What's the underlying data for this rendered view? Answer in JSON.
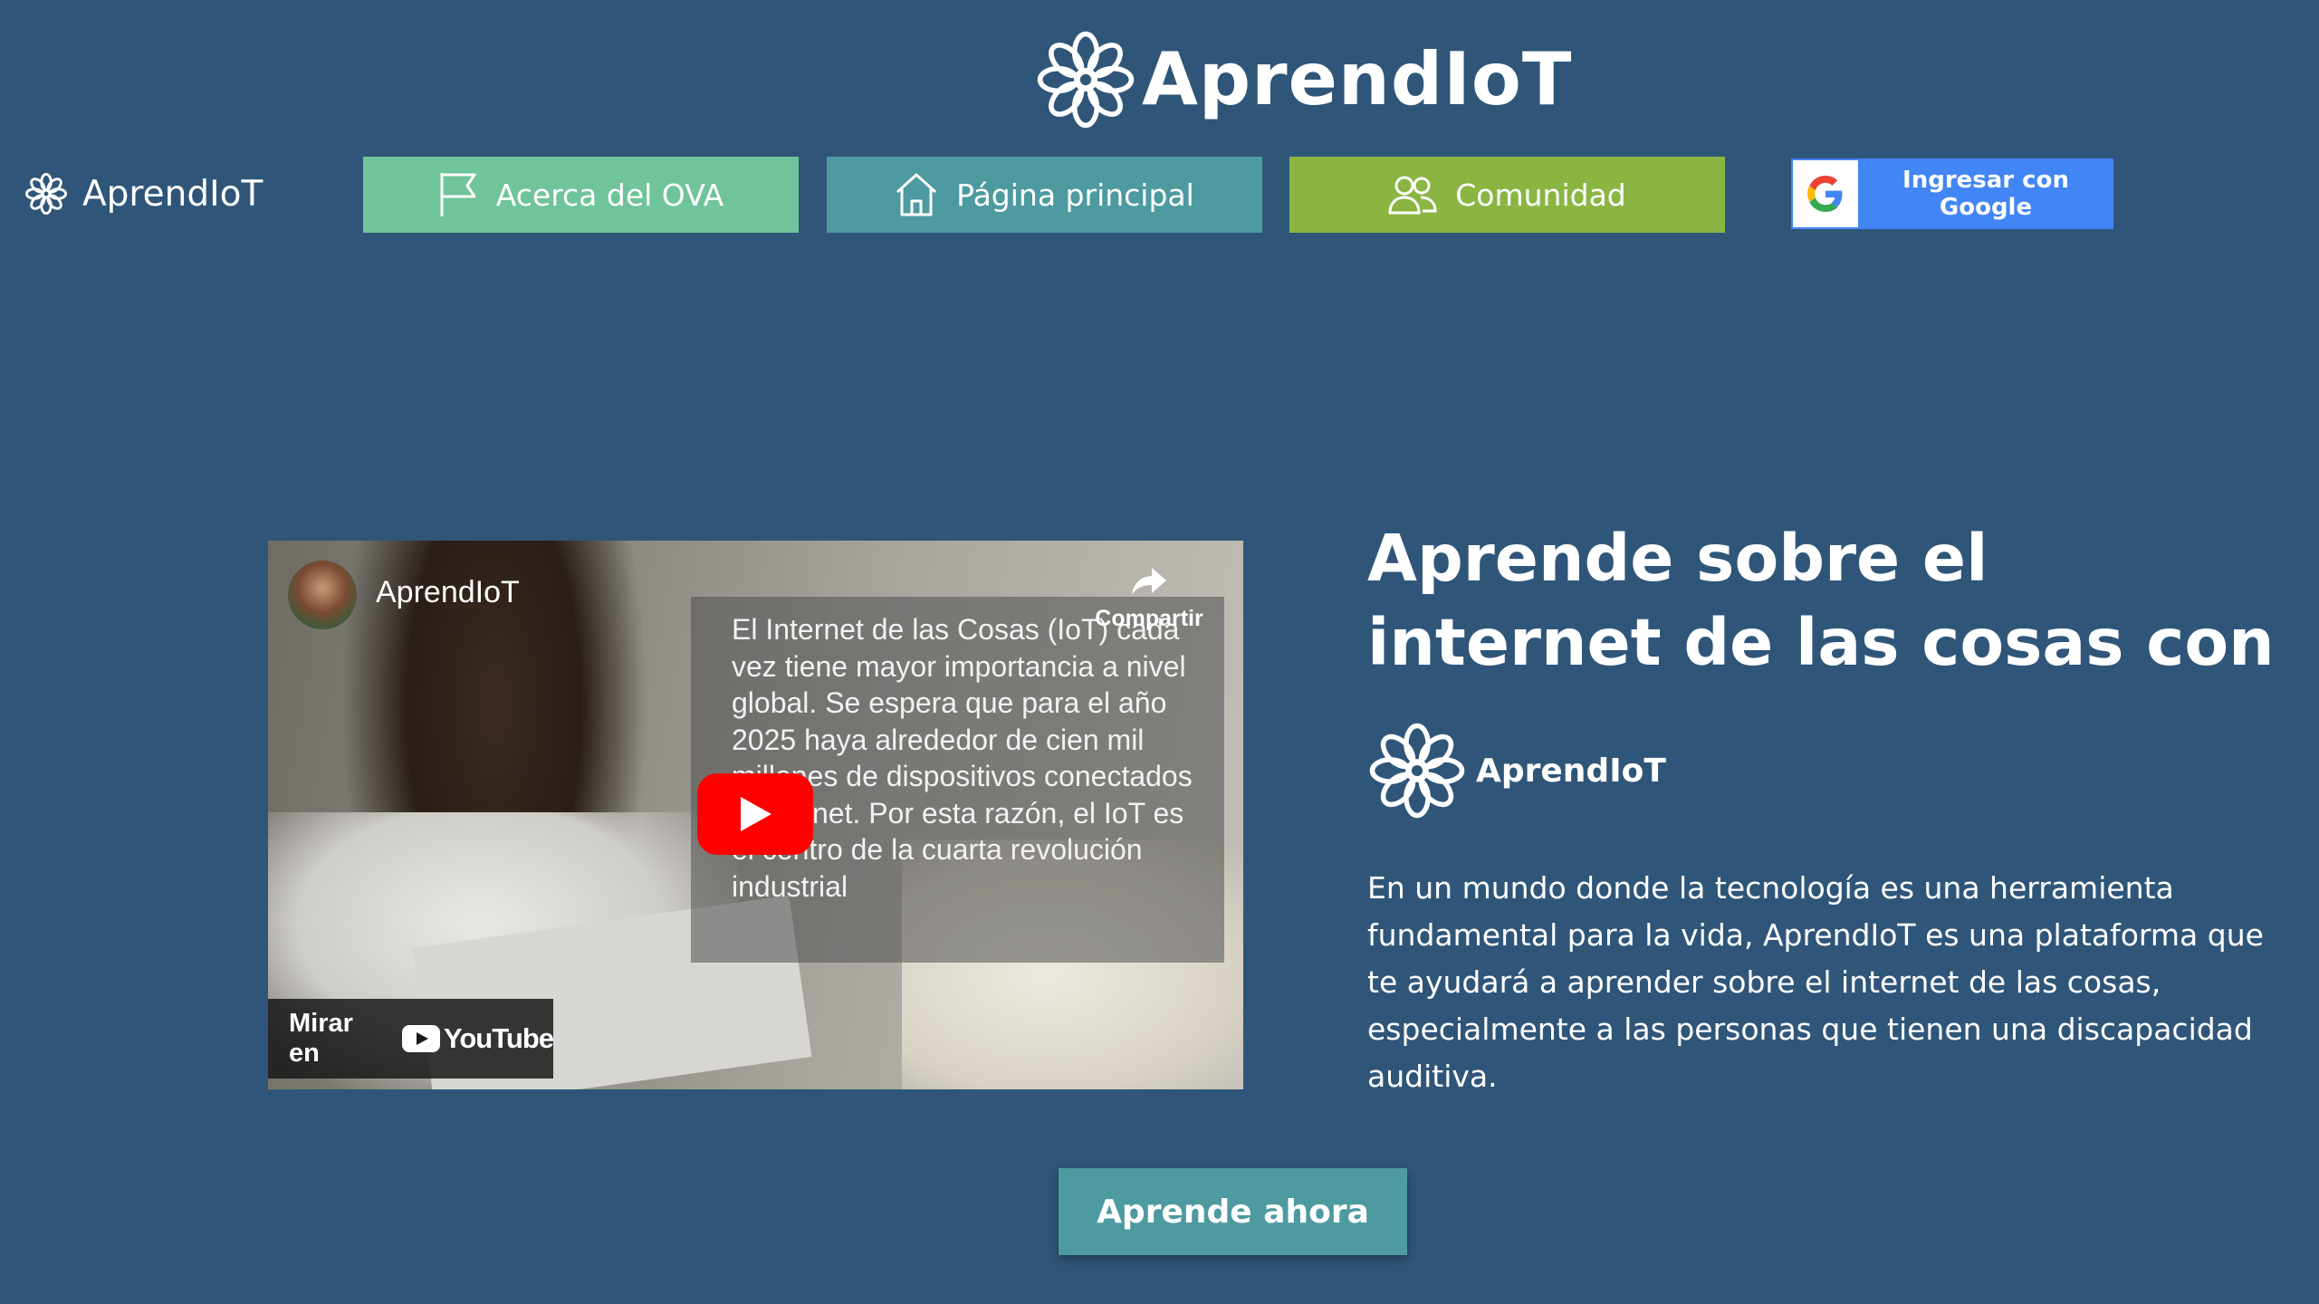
{
  "brand": {
    "name": "AprendIoT"
  },
  "nav": {
    "logo_text": "AprendIoT",
    "buttons": [
      {
        "label": "Acerca del OVA",
        "icon": "flag-icon",
        "color": "#6fc49a"
      },
      {
        "label": "Página principal",
        "icon": "home-icon",
        "color": "#4d9aa0"
      },
      {
        "label": "Comunidad",
        "icon": "users-icon",
        "color": "#8bb543"
      }
    ],
    "google": {
      "label": "Ingresar con Google",
      "icon": "google-icon",
      "color": "#4285f4"
    }
  },
  "video": {
    "channel": "AprendIoT",
    "share_label": "Compartir",
    "overlay_text": "El Internet de las Cosas (IoT) cada vez tiene mayor importancia a nivel global. Se espera que para el año 2025 haya alrededor de cien mil millones de dispositivos conectados a internet. Por esta razón, el IoT es el centro de la cuarta revolución industrial",
    "watch_label": "Mirar en",
    "youtube_label": "YouTube"
  },
  "hero": {
    "title": "Aprende sobre el internet de las cosas con",
    "logo_text": "AprendIoT",
    "description": "En un mundo donde la tecnología es una herramienta fundamental para la vida, AprendIoT es una plataforma que te ayudará a aprender sobre el internet de las cosas, especialmente a las personas que tienen una discapacidad auditiva.",
    "cta_label": "Aprende ahora"
  },
  "colors": {
    "background": "#2f5679",
    "accent_teal": "#4d9aa0",
    "accent_green": "#8bb543",
    "accent_mint": "#6fc49a"
  }
}
